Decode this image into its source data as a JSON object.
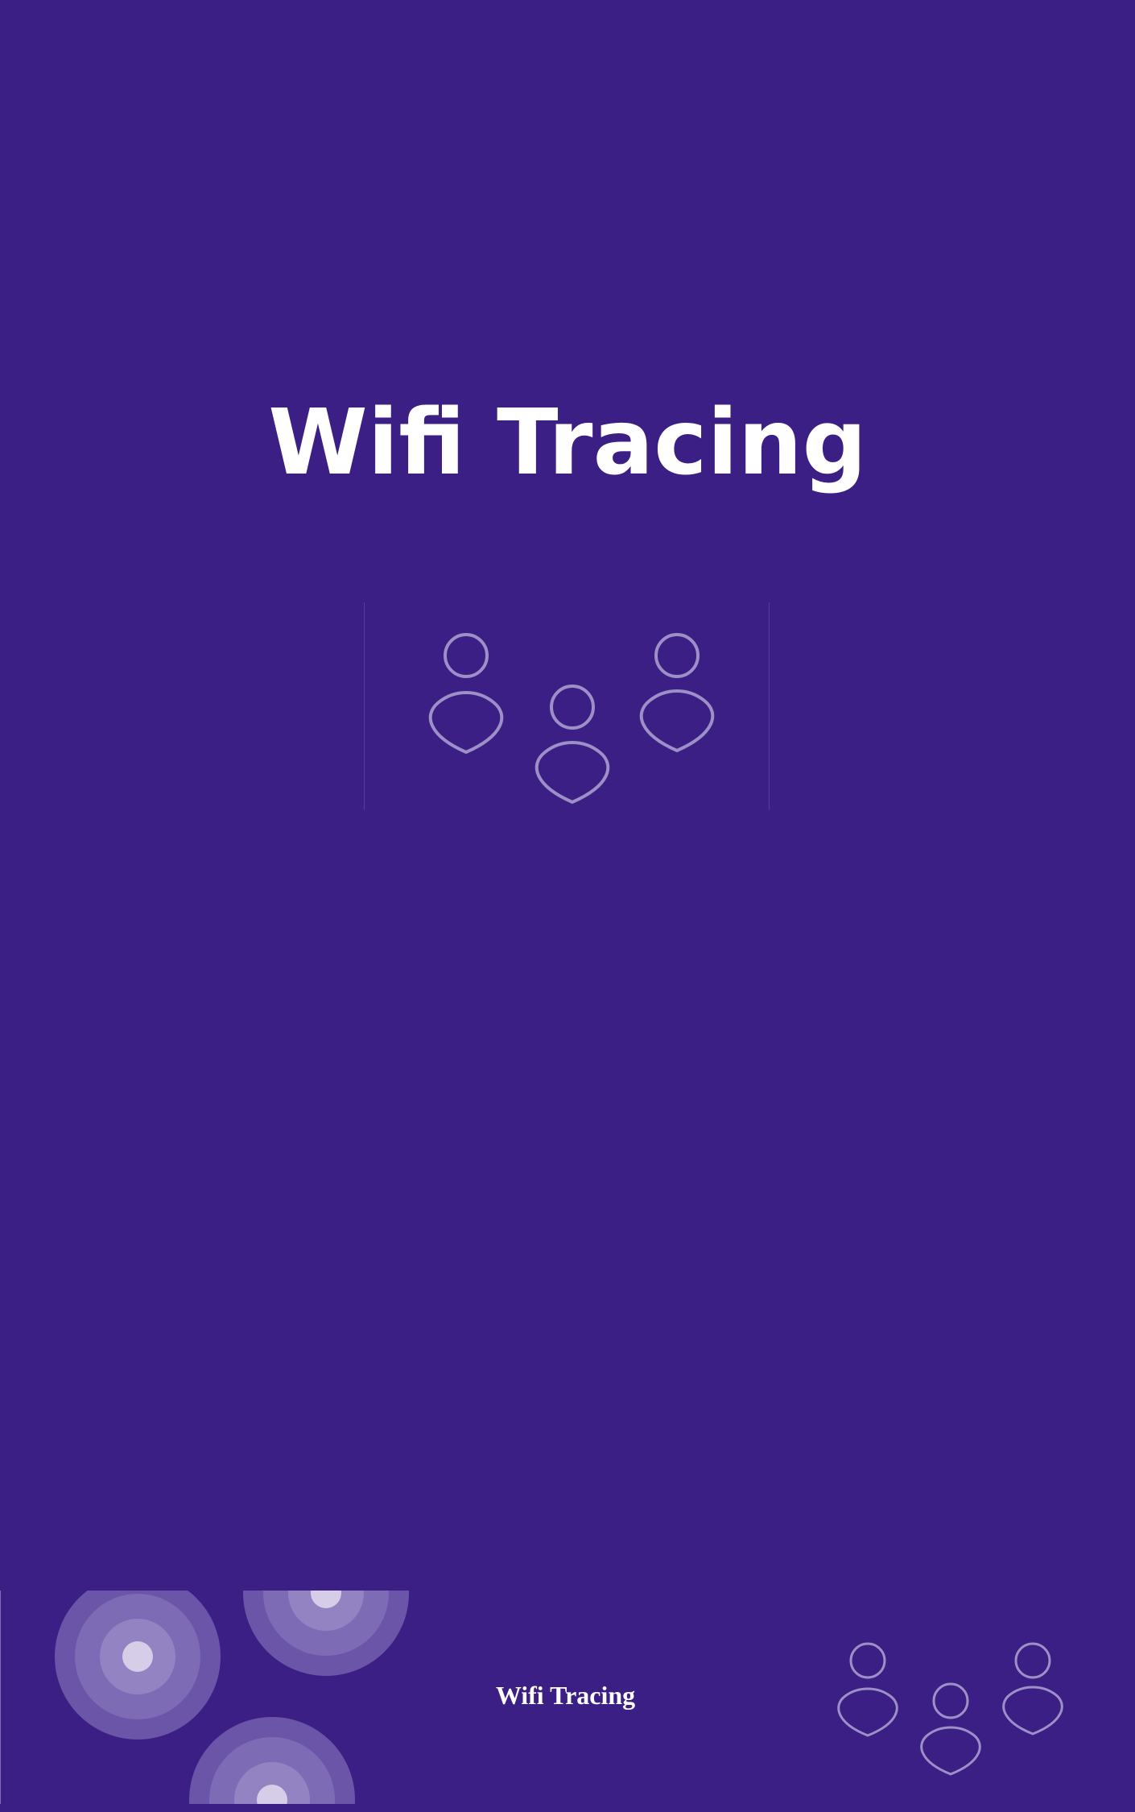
{
  "app": {
    "title": "Wifi Tracing"
  },
  "footer": {
    "title": "Wifi Tracing"
  },
  "icons": {
    "hero": "people-group-icon",
    "footer_left": "wifi-signal-rings-icon",
    "footer_right": "people-group-icon"
  },
  "colors": {
    "background": "#3b1f84",
    "text": "#ffffff",
    "icon_outline": "#9d8fc7",
    "ring_outer": "#6a55a8",
    "ring_mid": "#7e6bb5",
    "ring_inner": "#9483c3",
    "ring_core": "#d6cde9"
  }
}
